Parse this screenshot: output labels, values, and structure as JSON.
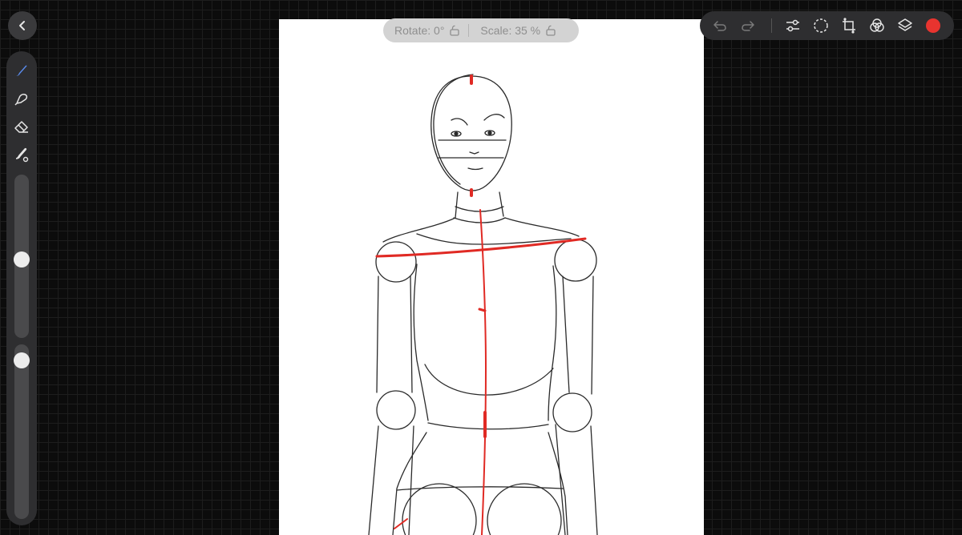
{
  "app": {
    "back_icon": "chevron-left-icon"
  },
  "left_toolbar": {
    "tools": [
      {
        "name": "brush",
        "icon": "brush-icon",
        "active": true
      },
      {
        "name": "smudge",
        "icon": "smudge-icon"
      },
      {
        "name": "eraser",
        "icon": "eraser-icon"
      },
      {
        "name": "color-fill",
        "icon": "color-fill-icon"
      }
    ],
    "brush_size_level": 0.52,
    "opacity_level": 0.95
  },
  "transform_bar": {
    "rotate_label": "Rotate: 0°",
    "scale_label": "Scale: 35 %",
    "lock_icon": "unlock-icon"
  },
  "top_toolbar": {
    "buttons": [
      "undo-icon",
      "redo-icon",
      "adjustments-icon",
      "selection-icon",
      "transform-icon",
      "blend-icon",
      "layers-icon"
    ],
    "current_color": "#e8342f"
  },
  "colors": {
    "accent_blue": "#5b8def",
    "sketch_red": "#e02a24",
    "toolbar_bg": "#2e2e30"
  }
}
